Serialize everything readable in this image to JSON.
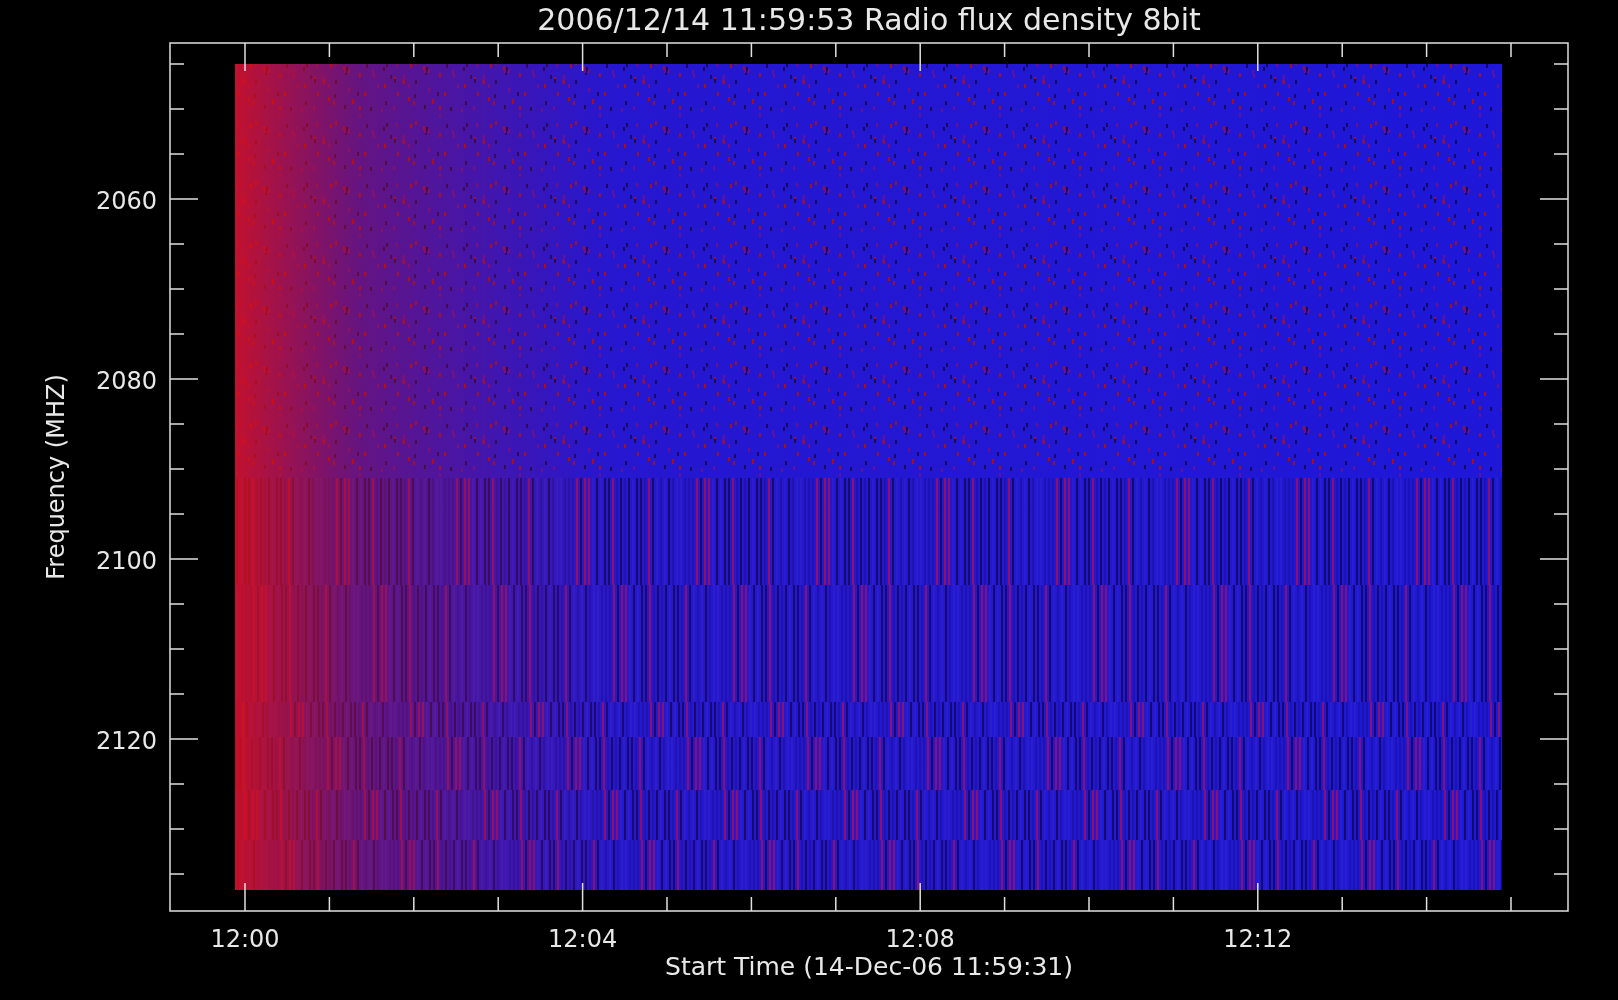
{
  "plot": {
    "title": "2006/12/14 11:59:53 Radio flux density 8bit",
    "y_axis": {
      "label": "Frequency (MHZ)",
      "ticks": [
        "2060",
        "2080",
        "2100",
        "2120"
      ]
    },
    "x_axis": {
      "label": "Start Time (14-Dec-06 11:59:31)",
      "ticks": [
        "12:00",
        "12:04",
        "12:08",
        "12:12"
      ]
    }
  }
}
